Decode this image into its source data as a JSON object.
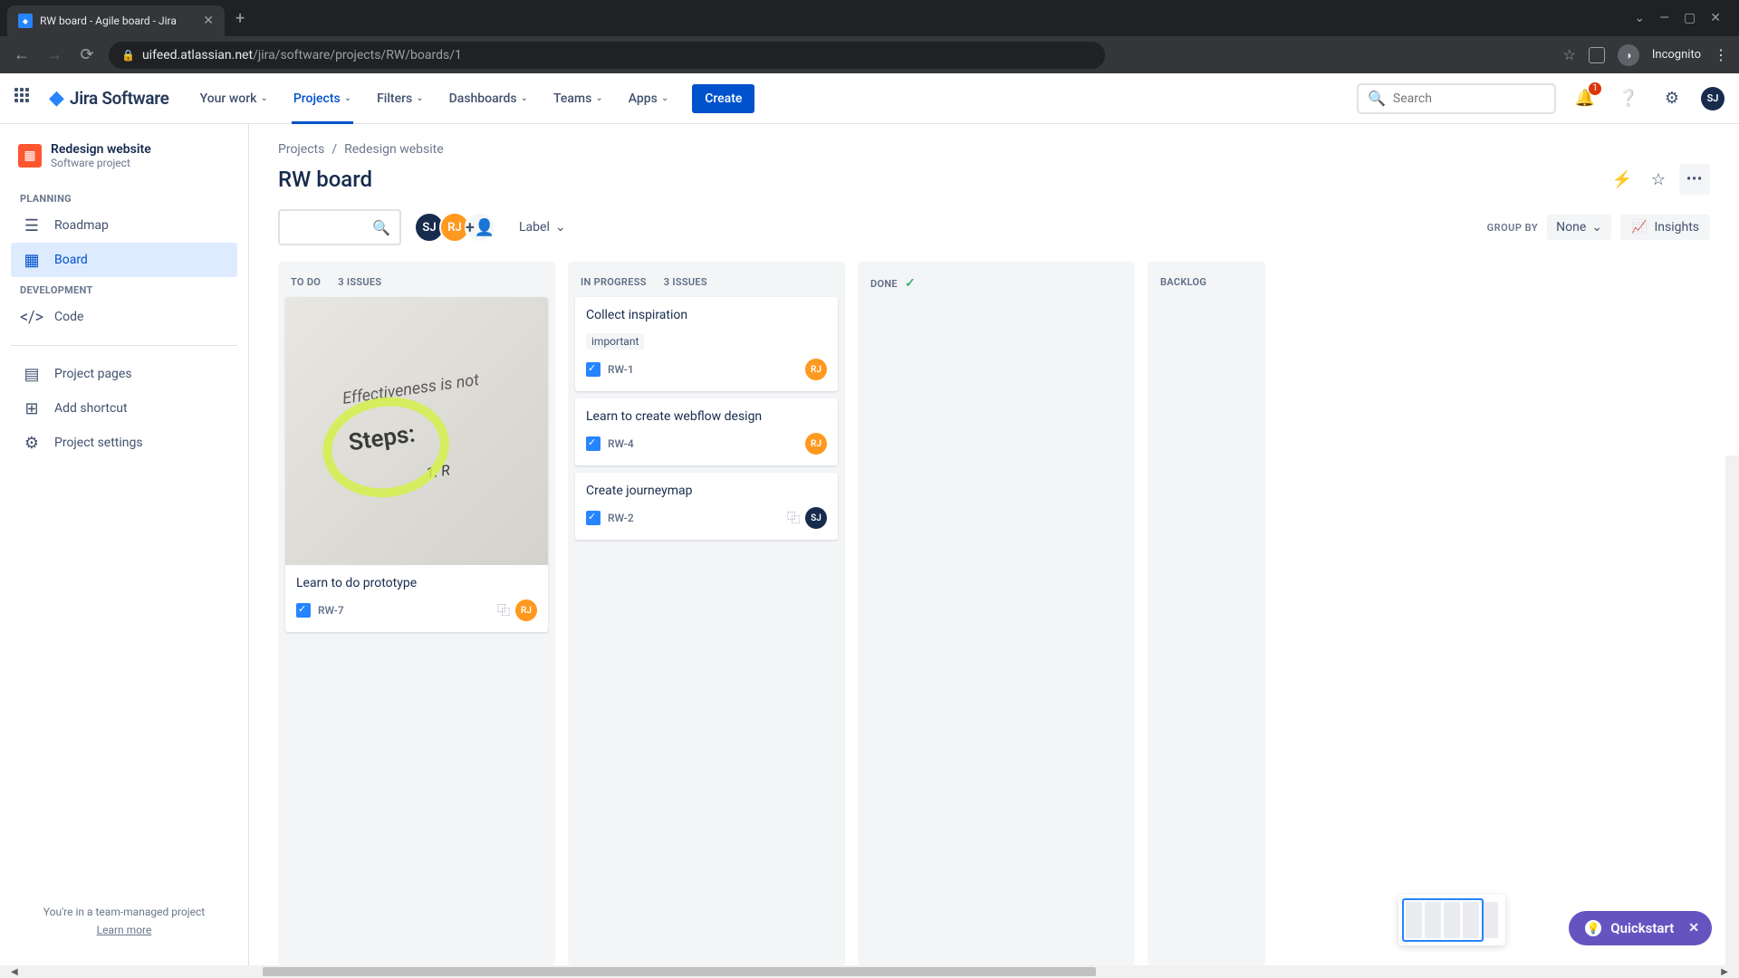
{
  "browser": {
    "tab_title": "RW board - Agile board - Jira",
    "url_host": "uifeed.atlassian.net",
    "url_path": "/jira/software/projects/RW/boards/1",
    "incognito_label": "Incognito"
  },
  "topnav": {
    "logo_text": "Jira Software",
    "items": [
      {
        "label": "Your work"
      },
      {
        "label": "Projects"
      },
      {
        "label": "Filters"
      },
      {
        "label": "Dashboards"
      },
      {
        "label": "Teams"
      },
      {
        "label": "Apps"
      }
    ],
    "create_label": "Create",
    "search_placeholder": "Search",
    "notif_count": "1",
    "user_initials": "SJ"
  },
  "sidebar": {
    "project_name": "Redesign website",
    "project_type": "Software project",
    "planning_label": "PLANNING",
    "development_label": "DEVELOPMENT",
    "items": {
      "roadmap": "Roadmap",
      "board": "Board",
      "code": "Code",
      "pages": "Project pages",
      "shortcut": "Add shortcut",
      "settings": "Project settings"
    },
    "footer_line": "You're in a team-managed project",
    "footer_link": "Learn more"
  },
  "breadcrumb": {
    "projects": "Projects",
    "project": "Redesign website"
  },
  "header": {
    "title": "RW board"
  },
  "toolbar": {
    "avatars": [
      {
        "initials": "SJ",
        "cls": "sj"
      },
      {
        "initials": "RJ",
        "cls": "rj"
      }
    ],
    "label_filter": "Label",
    "group_by_label": "GROUP BY",
    "group_by_value": "None",
    "insights_label": "Insights"
  },
  "columns": {
    "todo": {
      "title": "TO DO",
      "count": "3 ISSUES"
    },
    "inprogress": {
      "title": "IN PROGRESS",
      "count": "3 ISSUES"
    },
    "done": {
      "title": "DONE"
    },
    "backlog": {
      "title": "BACKLOG"
    }
  },
  "cards": {
    "todo": [
      {
        "title": "Learn to do prototype",
        "key": "RW-7",
        "assignee": "RJ",
        "assignee_cls": "rj",
        "has_image": true,
        "has_tree": true
      }
    ],
    "inprogress": [
      {
        "title": "Collect inspiration",
        "key": "RW-1",
        "tag": "important",
        "assignee": "RJ",
        "assignee_cls": "rj"
      },
      {
        "title": "Learn to create webflow design",
        "key": "RW-4",
        "assignee": "RJ",
        "assignee_cls": "rj"
      },
      {
        "title": "Create journeymap",
        "key": "RW-2",
        "assignee": "SJ",
        "assignee_cls": "sj",
        "has_tree": true
      }
    ]
  },
  "image_text": {
    "line1": "Effectiveness is not",
    "line2": "Steps:",
    "line3": "1. R"
  },
  "quickstart": {
    "label": "Quickstart"
  }
}
